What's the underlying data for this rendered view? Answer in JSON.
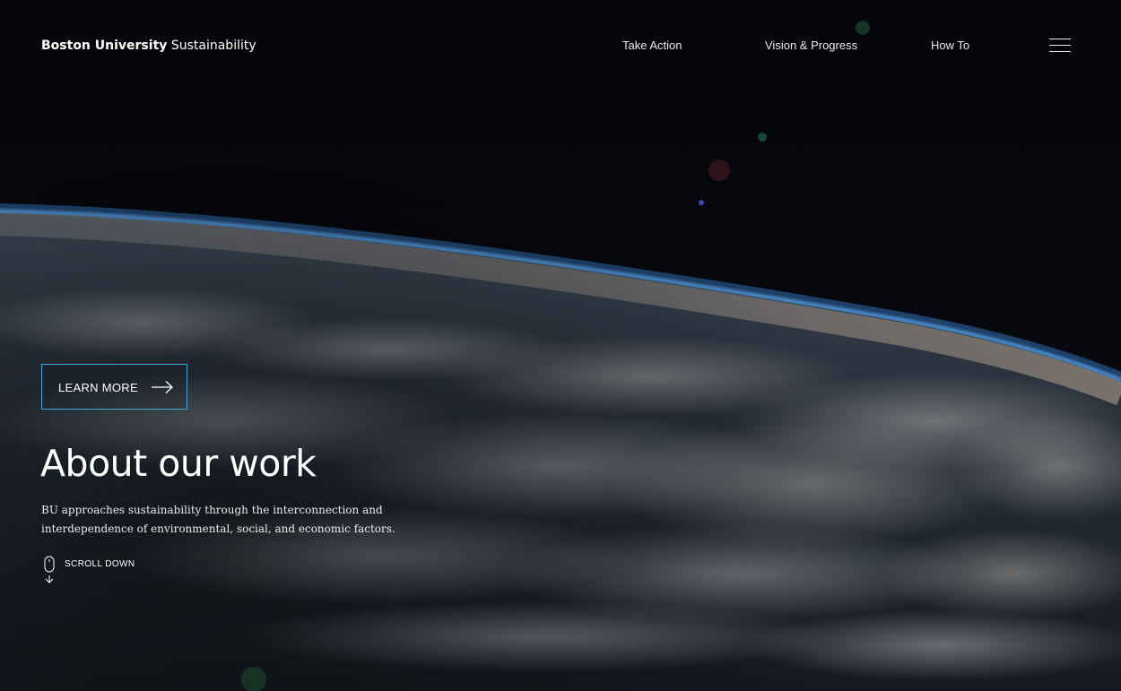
{
  "header": {
    "brand_strong": "Boston University",
    "brand_light": "Sustainability",
    "nav": [
      "Take Action",
      "Vision & Progress",
      "How To"
    ],
    "menu_icon": "hamburger-menu-icon"
  },
  "hero": {
    "cta_label": "LEARN MORE",
    "cta_icon": "arrow-right-icon",
    "title": "About our work",
    "description": "BU approaches sustainability through the interconnection and interdependence of environmental, social, and economic factors.",
    "scroll_label": "SCROLL DOWN",
    "scroll_icon": "mouse-scroll-icon"
  },
  "colors": {
    "cta_border": "#3fa4d8",
    "text": "#ffffff",
    "space": "#05070b"
  }
}
